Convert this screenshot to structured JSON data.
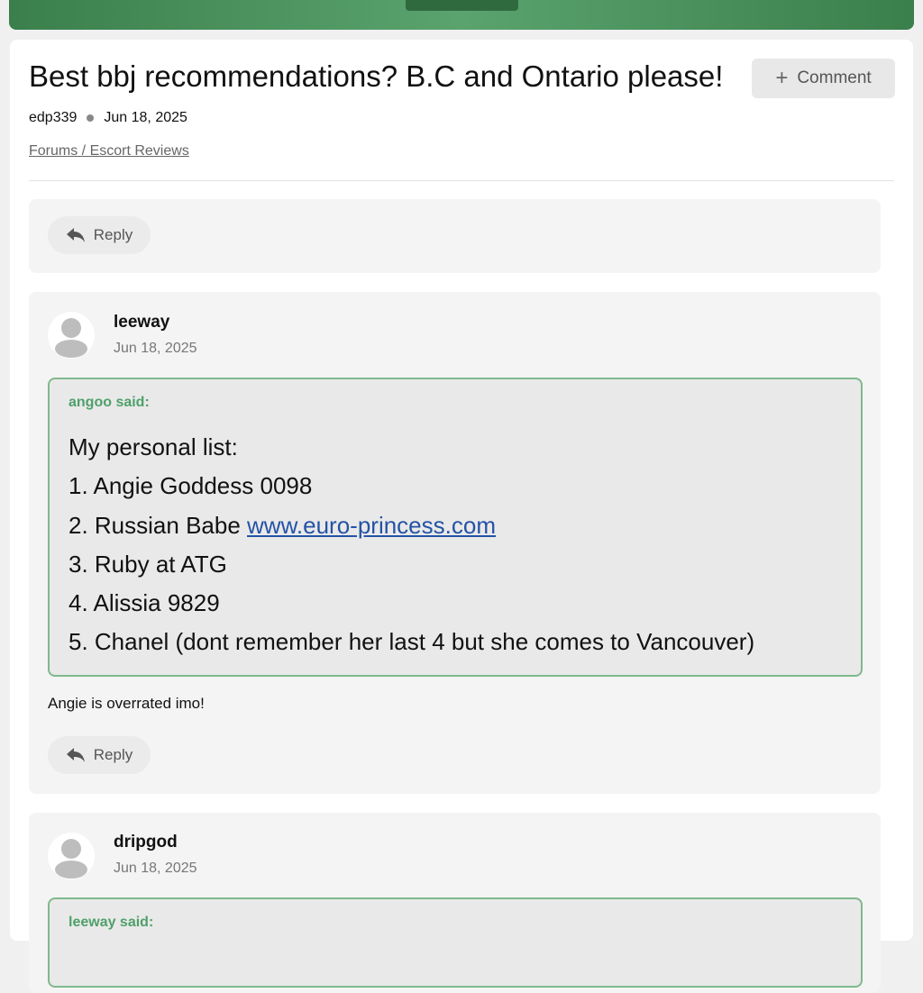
{
  "thread": {
    "title": "Best bbj recommendations? B.C and Ontario please!",
    "author": "edp339",
    "date": "Jun 18, 2025",
    "breadcrumb": "Forums / Escort Reviews",
    "comment_label": "Comment"
  },
  "posts": [
    {
      "reply_label": "Reply"
    },
    {
      "username": "leeway",
      "date": "Jun 18, 2025",
      "quote": {
        "said": "angoo said:",
        "lines": [
          "My personal list:",
          "1. Angie Goddess 0098",
          "2. Russian Babe ",
          "3. Ruby at ATG",
          "4. Alissia 9829",
          "5. Chanel (dont remember her last 4 but she comes to Vancouver)"
        ],
        "link_text": "www.euro-princess.com"
      },
      "text": "Angie is overrated imo!",
      "reply_label": "Reply"
    },
    {
      "username": "dripgod",
      "date": "Jun 18, 2025",
      "quote": {
        "said": "leeway said:"
      }
    }
  ],
  "icons": {
    "reply": "reply-arrow-icon",
    "comment": "plus-icon",
    "avatar": "user-avatar-icon"
  }
}
